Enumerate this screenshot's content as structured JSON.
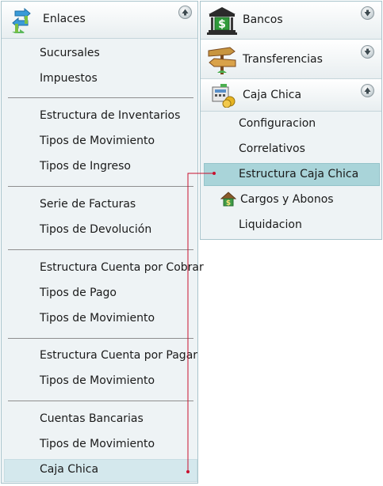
{
  "left_panel": {
    "title": "Enlaces",
    "groups": [
      {
        "items": [
          "Sucursales",
          "Impuestos"
        ]
      },
      {
        "items": [
          "Estructura de Inventarios",
          "Tipos de Movimiento",
          "Tipos de Ingreso"
        ]
      },
      {
        "items": [
          "Serie de Facturas",
          "Tipos de Devolución"
        ]
      },
      {
        "items": [
          "Estructura Cuenta por Cobrar",
          "Tipos de Pago",
          "Tipos de Movimiento"
        ]
      },
      {
        "items": [
          "Estructura Cuenta por Pagar",
          "Tipos de Movimiento"
        ]
      },
      {
        "items": [
          "Cuentas Bancarias",
          "Tipos de Movimiento",
          "Caja Chica"
        ]
      }
    ],
    "selected": "Caja Chica"
  },
  "right_panel": {
    "sections": [
      {
        "title": "Bancos",
        "icon": "bank-icon",
        "state": "collapsed"
      },
      {
        "title": "Transferencias",
        "icon": "signpost-icon",
        "state": "collapsed"
      },
      {
        "title": "Caja Chica",
        "icon": "cash-register-icon",
        "state": "expanded"
      }
    ],
    "items": [
      "Configuracion",
      "Correlativos",
      "Estructura Caja Chica",
      "Cargos y Abonos",
      "Liquidacion"
    ],
    "selected": "Estructura Caja Chica"
  },
  "colors": {
    "connector": "#c8102e",
    "left_selected_bg": "#d4e8ed",
    "right_selected_bg": "#a9d4d9",
    "panel_bg": "#eef3f5",
    "border": "#a9c4cc"
  }
}
